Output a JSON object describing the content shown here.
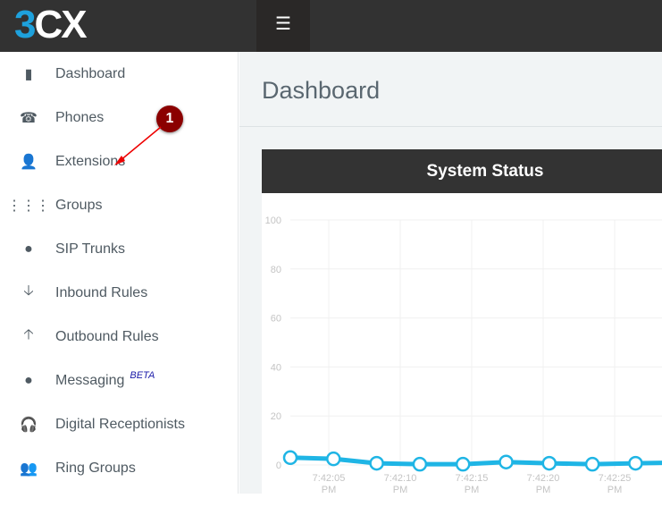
{
  "header": {
    "logo": "3CX",
    "menu_icon": "hamburger-icon"
  },
  "sidebar": {
    "items": [
      {
        "label": "Dashboard",
        "icon": "bar-chart-icon",
        "glyph": "▮"
      },
      {
        "label": "Phones",
        "icon": "phone-icon",
        "glyph": "☎"
      },
      {
        "label": "Extensions",
        "icon": "user-icon",
        "glyph": "👤"
      },
      {
        "label": "Groups",
        "icon": "grid-icon",
        "glyph": "⋮⋮⋮"
      },
      {
        "label": "SIP Trunks",
        "icon": "globe-icon",
        "glyph": "●"
      },
      {
        "label": "Inbound Rules",
        "icon": "arrow-down-icon",
        "glyph": "🡣"
      },
      {
        "label": "Outbound Rules",
        "icon": "arrow-up-icon",
        "glyph": "🡡"
      },
      {
        "label": "Messaging",
        "badge": "BETA",
        "icon": "comment-icon",
        "glyph": "●"
      },
      {
        "label": "Digital Receptionists",
        "icon": "headset-icon",
        "glyph": "🎧"
      },
      {
        "label": "Ring Groups",
        "icon": "users-icon",
        "glyph": "👥"
      }
    ]
  },
  "main": {
    "title": "Dashboard",
    "panel_title": "System Status"
  },
  "annotation": {
    "number": "1",
    "color": "#8b0000"
  },
  "chart_data": {
    "type": "line",
    "title": "",
    "ylim": [
      0,
      100
    ],
    "yticks": [
      0,
      20,
      40,
      60,
      80,
      100
    ],
    "grid": true,
    "xtick_labels": [
      "7:42:05 PM",
      "7:42:10 PM",
      "7:42:15 PM",
      "7:42:20 PM",
      "7:42:25 PM"
    ],
    "series": [
      {
        "color": "#1fb5e5",
        "values": [
          3,
          2.5,
          0.7,
          0.3,
          0.3,
          1.2,
          0.7,
          0.3,
          0.7,
          1
        ]
      }
    ]
  }
}
